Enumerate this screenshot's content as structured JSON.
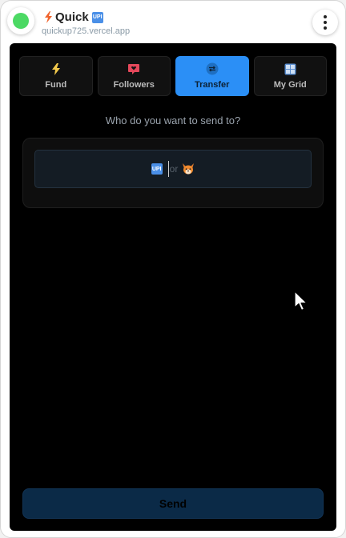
{
  "header": {
    "title": "Quick",
    "upi_badge": "UPI",
    "url": "quickup725.vercel.app"
  },
  "tabs": [
    {
      "label": "Fund",
      "icon": "lightning-icon",
      "active": false
    },
    {
      "label": "Followers",
      "icon": "heart-message-icon",
      "active": false
    },
    {
      "label": "Transfer",
      "icon": "transfer-icon",
      "active": true
    },
    {
      "label": "My Grid",
      "icon": "grid-icon",
      "active": false
    }
  ],
  "prompt": "Who do you want to send to?",
  "recipient": {
    "upi_badge": "UPI",
    "or_text": "or",
    "value": ""
  },
  "send_label": "Send",
  "colors": {
    "status": "#4cd964",
    "accent": "#2b8ff6",
    "panel_bg": "#000000",
    "send_bg": "#0b2a47"
  }
}
